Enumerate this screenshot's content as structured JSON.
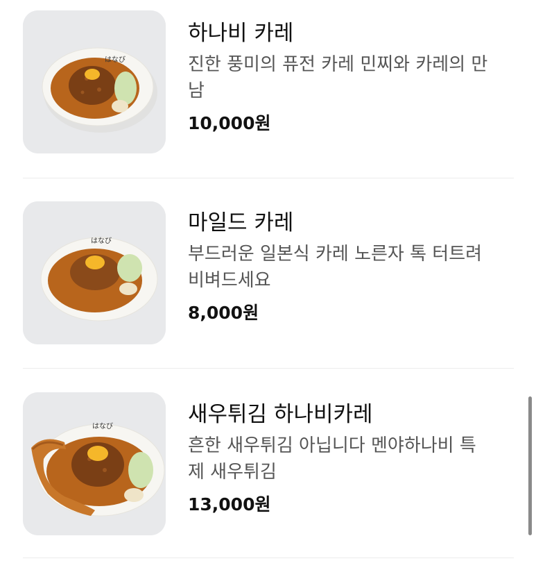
{
  "menu": {
    "items": [
      {
        "name": "하나비 카레",
        "desc_line1": "진한 풍미의 퓨전 카레 민찌와 카레의 만",
        "desc_line2": "남",
        "price": "10,000원",
        "photo_icon": "curry-minced-egg-photo"
      },
      {
        "name": "마일드 카레",
        "desc_line1": "부드러운 일본식 카레 노른자 톡 터트려",
        "desc_line2": "비벼드세요",
        "price": "8,000원",
        "photo_icon": "curry-egg-photo"
      },
      {
        "name": "새우튀김 하나비카레",
        "desc_line1": "흔한 새우튀김 아닙니다 멘야하나비 특",
        "desc_line2": "제 새우튀김",
        "price": "13,000원",
        "photo_icon": "curry-fried-shrimp-photo"
      }
    ]
  },
  "colors": {
    "plate": "#f7f6f2",
    "curry": "#b8651c",
    "mince": "#7a3f15",
    "yolk": "#f5b72a",
    "greens": "#cfe3b0"
  }
}
